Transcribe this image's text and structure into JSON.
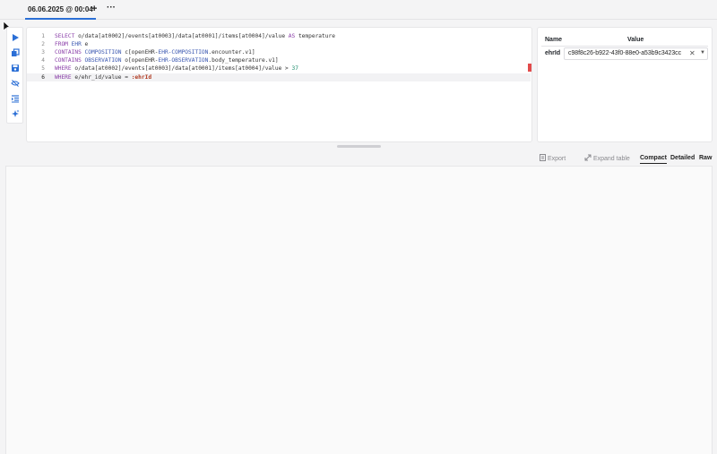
{
  "tabs": [
    {
      "label": "06.06.2025 @ 00:04"
    }
  ],
  "tab_add_label": "+",
  "tab_more_label": "···",
  "toolbar": {
    "icons": [
      "run-icon",
      "copy-icon",
      "save-icon",
      "hide-icon",
      "format-icon",
      "sparkle-icon"
    ]
  },
  "editor": {
    "lines": [
      {
        "n": "1",
        "tokens": [
          [
            "kw",
            "SELECT "
          ],
          [
            "t",
            "o/data[at0002]/events[at0003]/data[at0001]/items[at0004]/value "
          ],
          [
            "kw",
            "AS "
          ],
          [
            "t",
            "temperature"
          ]
        ]
      },
      {
        "n": "2",
        "tokens": [
          [
            "kw",
            "FROM "
          ],
          [
            "id",
            "EHR "
          ],
          [
            "t",
            "e"
          ]
        ]
      },
      {
        "n": "3",
        "tokens": [
          [
            "kw",
            "CONTAINS "
          ],
          [
            "id",
            "COMPOSITION "
          ],
          [
            "t",
            "c[openEHR-"
          ],
          [
            "id",
            "EHR-COMPOSITION"
          ],
          [
            "t",
            ".encounter.v1]"
          ]
        ]
      },
      {
        "n": "4",
        "tokens": [
          [
            "kw",
            "CONTAINS "
          ],
          [
            "id",
            "OBSERVATION "
          ],
          [
            "t",
            "o[openEHR-"
          ],
          [
            "id",
            "EHR-OBSERVATION"
          ],
          [
            "t",
            ".body_temperature.v1]"
          ]
        ]
      },
      {
        "n": "5",
        "tokens": [
          [
            "kw",
            "WHERE "
          ],
          [
            "t",
            "o/data[at0002]/events[at0003]/data[at0001]/items[at0004]/value > "
          ],
          [
            "num",
            "37"
          ]
        ]
      },
      {
        "n": "6",
        "tokens": [
          [
            "kw",
            "WHERE "
          ],
          [
            "t",
            "e/ehr_id/value = "
          ],
          [
            "param",
            ":ehrId"
          ]
        ]
      }
    ],
    "active_line": 6
  },
  "params": {
    "header_name": "Name",
    "header_value": "Value",
    "rows": [
      {
        "name": "ehrId",
        "value": "c98f8c26-b922-43f0-88e0-a53b9c3423cc",
        "clear": "✕",
        "chevron": "▼"
      }
    ]
  },
  "results_toolbar": {
    "export_label": "Export",
    "expand_label": "Expand table",
    "compact_label": "Compact",
    "detailed_label": "Detailed",
    "raw_label": "Raw",
    "active_view": "Compact"
  },
  "colors": {
    "accent": "#2b6fd6",
    "run": "#2b6fd6",
    "error": "#e24b4b"
  }
}
